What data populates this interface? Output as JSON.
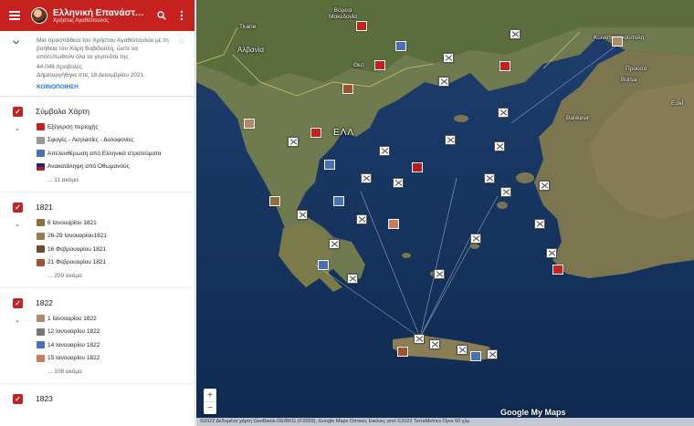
{
  "header": {
    "title": "Ελληνική Επανάσταση",
    "subtitle": "Χρήστος Αγαθόπουλος"
  },
  "description": {
    "text": "Μια προσπάθεια του Χρήστου Αγαθόπουλου με τη βοήθεια του Χάρη Βαβιδούλη, ώστε να αποτυπωθούν όλα τα γεγονότα της",
    "views": "44.046 προβολές",
    "created": "Δημιουργήθηκε στις 18 Δεκεμβρίου 2021",
    "share": "ΚΟΙΝΟΠΟΙΗΣΗ"
  },
  "layers": [
    {
      "name": "Σύμβολα Χάρτη",
      "items": [
        {
          "label": "Εξέγερση περιοχής",
          "icon": "flag-icon",
          "color": "#c5221f"
        },
        {
          "label": "Σφαγές - Λεηλασίες - Δολοφονίες",
          "icon": "skull-icon",
          "color": "#777777"
        },
        {
          "label": "Απελευθέρωση από Ελληνικά στρατεύματα",
          "icon": "liberation-icon",
          "color": "#4a6fb5"
        },
        {
          "label": "Ανακατάληψη από Οθωμανούς",
          "icon": "ottoman-icon",
          "color": "#b71c1c"
        }
      ],
      "more": "... 11 ακόμα"
    },
    {
      "name": "1821",
      "items": [
        {
          "label": "6 Ιανουαρίου 1821",
          "icon": "painting-icon",
          "color": "#8d6e3f"
        },
        {
          "label": "26-29 Ιανουαρίου1821",
          "icon": "painting-icon",
          "color": "#9e7b4f"
        },
        {
          "label": "16 Φεβρουαρίου 1821",
          "icon": "painting-icon",
          "color": "#6d4c2e"
        },
        {
          "label": "21 Φεβρουαρίου 1821",
          "icon": "painting-icon",
          "color": "#a0522d"
        }
      ],
      "more": "... 259 ακόμα"
    },
    {
      "name": "1822",
      "items": [
        {
          "label": "1 Ιανουαρίου 1822",
          "icon": "painting-icon",
          "color": "#b08968"
        },
        {
          "label": "12 Ιανουαρίου 1822",
          "icon": "swords-icon",
          "color": "#555555"
        },
        {
          "label": "14 Ιανουαρίου 1822",
          "icon": "liberation-icon",
          "color": "#4a6fb5"
        },
        {
          "label": "15 Ιανουαρίου 1822",
          "icon": "painting-icon",
          "color": "#c97b5a"
        }
      ],
      "more": "... 108 ακόμα"
    },
    {
      "name": "1823",
      "items": [],
      "more": ""
    }
  ],
  "map": {
    "labels": {
      "north_macedonia": "Βόρεια\nΜακεδονία",
      "albania": "Αλβανία",
      "tirane": "Tirane",
      "greece": "ΕΛΛ",
      "istanbul": "Κωνσταντινούπολη",
      "bursa": "Bursa",
      "prousa": "Προύσα",
      "thessaloniki": "Θεσ",
      "balikesir": "Balıkesir",
      "eskisehir": "Εσκί"
    },
    "zoom_in": "+",
    "zoom_out": "−",
    "brand": "Google My Maps",
    "attribution": "©2022 Δεδομένα χάρτη GeoBasis-DE/BKG (©2009), Google Maps Οπτικές Εικόνες από ©2022 TerraMetrics    Όροι    50 χλμ"
  }
}
